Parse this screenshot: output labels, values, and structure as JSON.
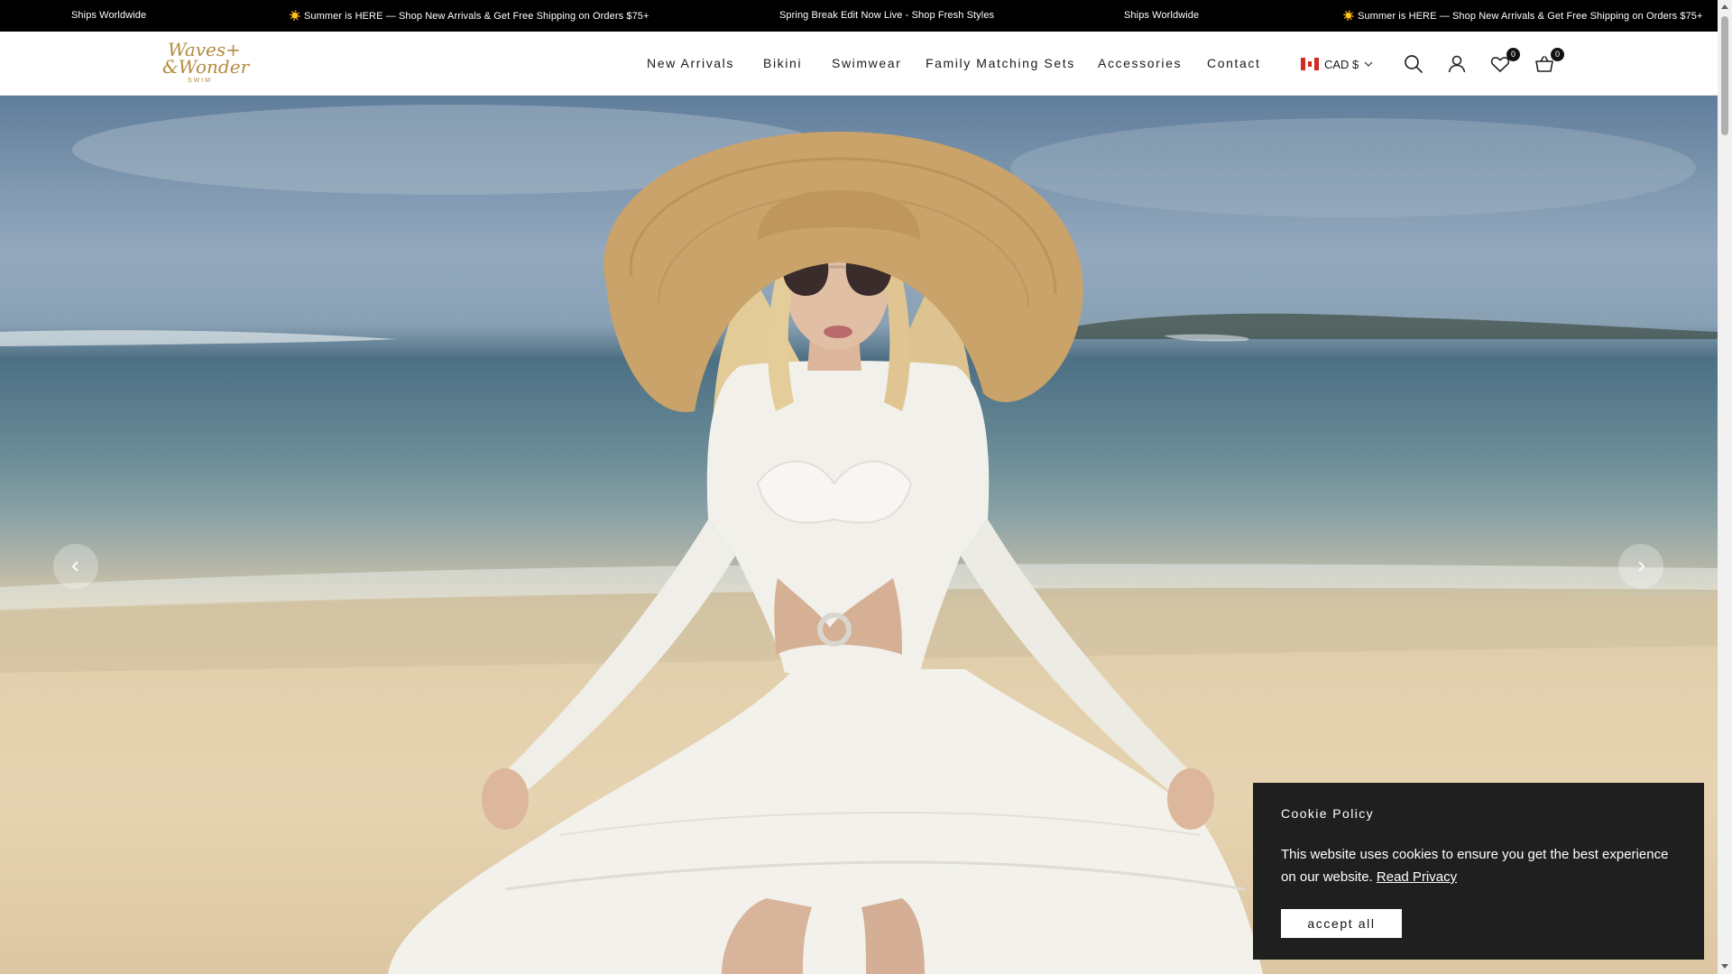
{
  "announcement": {
    "messages": [
      "Ships Worldwide",
      "☀️ Summer is HERE — Shop New Arrivals & Get Free Shipping on Orders $75+",
      "Spring Break Edit Now Live - Shop Fresh Styles",
      "Ships Worldwide",
      "☀️ Summer is HERE — Shop New Arrivals & Get Free Shipping on Orders $75+"
    ]
  },
  "header": {
    "logo": {
      "line1": "Waves+",
      "line2": "&Wonder",
      "line3": "SWIM"
    },
    "nav": [
      "New Arrivals",
      "Bikini",
      "Swimwear",
      "Family Matching Sets",
      "Accessories",
      "Contact"
    ],
    "currency": "CAD $",
    "icons": {
      "search": "search-icon",
      "account": "account-icon",
      "wishlist": "heart-icon",
      "cart": "cart-icon"
    },
    "wishlist_count": "0",
    "cart_count": "0"
  },
  "hero": {
    "image": "model in white crochet cover-up dress and wide straw hat on beach",
    "prev_icon": "chevron-left-icon",
    "next_icon": "chevron-right-icon"
  },
  "cookie": {
    "title": "Cookie Policy",
    "body": "This website uses cookies to ensure you get the best experience on our website.",
    "link": "Read Privacy",
    "button": "accept all"
  },
  "colors": {
    "announcement_bg": "#000000",
    "logo_gold": "#b58b3f",
    "cookie_bg": "#1f1f1f"
  }
}
